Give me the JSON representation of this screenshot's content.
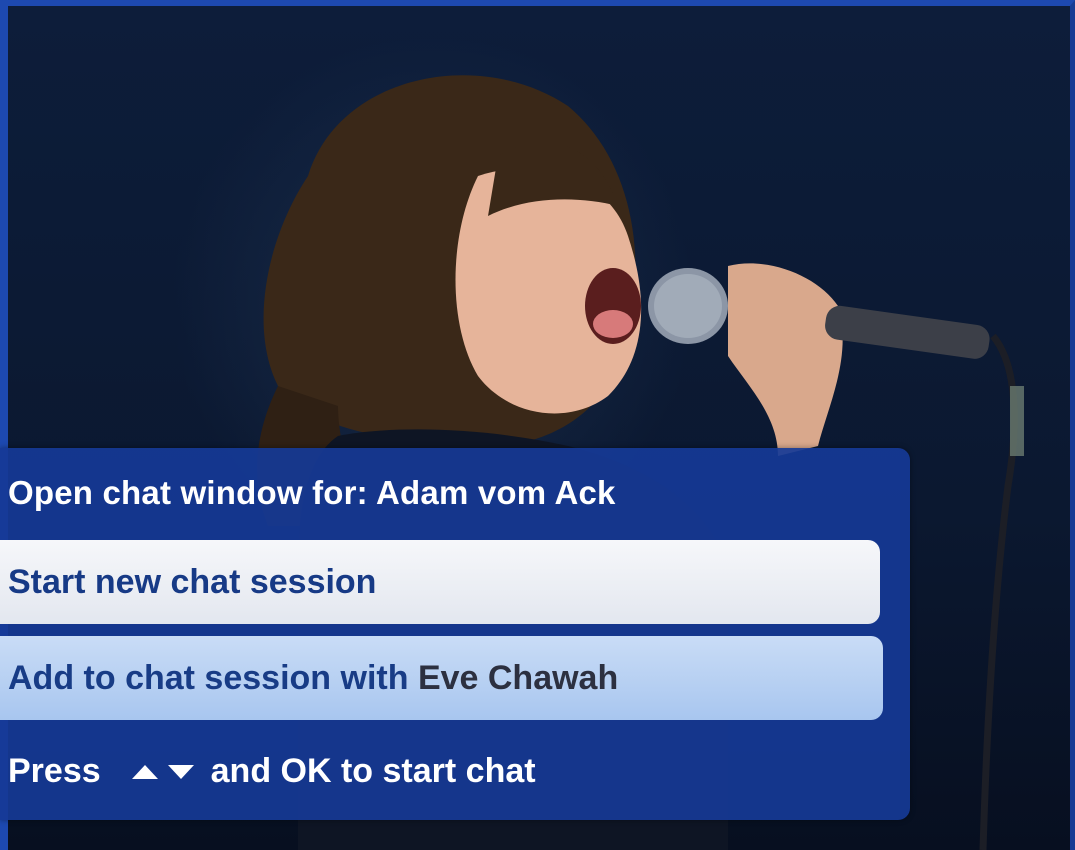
{
  "dialog": {
    "title": "Open chat window for: Adam vom Ack",
    "options": [
      {
        "label": "Start new chat session",
        "selected": true
      },
      {
        "label_prefix": "Add to chat session with ",
        "contact": "Eve Chawah",
        "selected": false
      }
    ],
    "hint": {
      "before": "Press",
      "icons": [
        "arrow-up-icon",
        "arrow-down-icon"
      ],
      "after": "and OK to start chat"
    }
  },
  "colors": {
    "frame": "#1d49b0",
    "dialog_bg": "#163a96",
    "option_selected_bg": "#f0f2f6",
    "option_bg": "#b8d2f3",
    "option_text": "#173a86"
  }
}
